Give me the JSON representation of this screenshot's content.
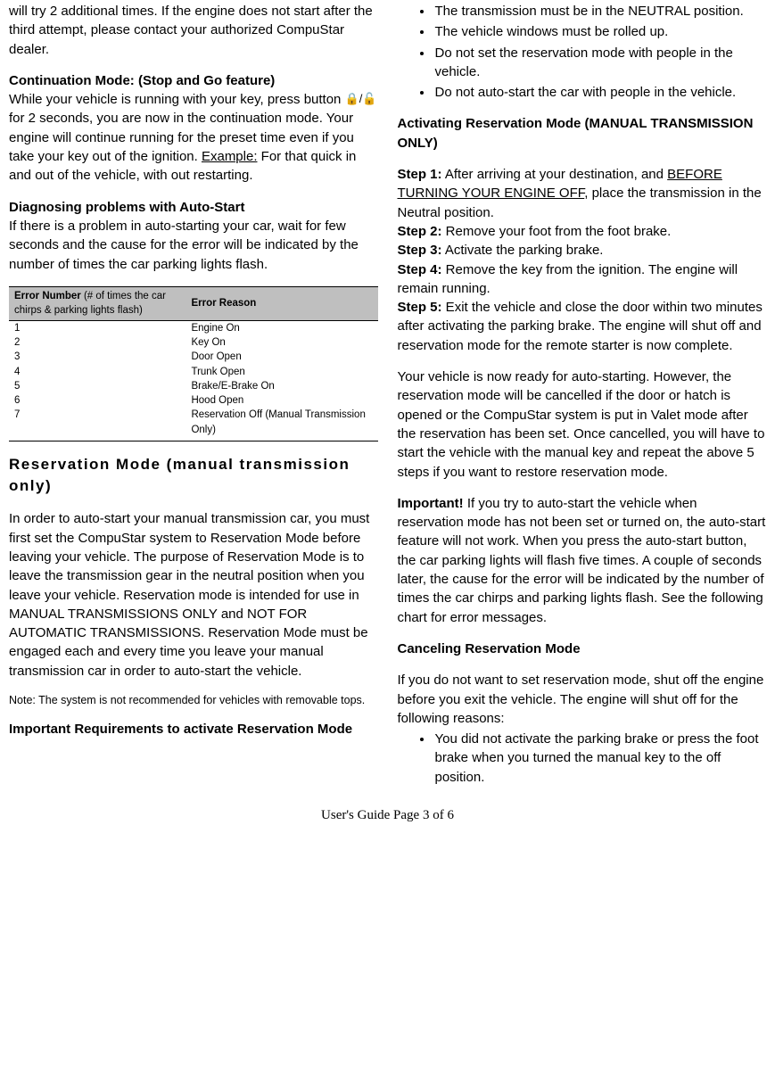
{
  "left": {
    "intro": "will try 2 additional times. If the engine does not start after the third attempt, please contact your authorized CompuStar dealer.",
    "cont_heading": "Continuation Mode: (Stop and Go feature)",
    "cont_body_a": "While your vehicle is running with your key, press button ",
    "cont_icon": "🔒/🔓",
    "cont_body_b": " for 2 seconds, you are now in the continuation mode.  Your engine will continue running for the preset time even if you take your key out of the ignition. ",
    "cont_example_label": "Example:",
    "cont_body_c": " For that quick in and out of the vehicle, with out restarting.",
    "diag_heading": "Diagnosing problems with Auto-Start",
    "diag_body": "If there is a problem in auto-starting your car, wait for few seconds and the cause for the error will be indicated by the number of times the car parking lights flash.",
    "table_h1a": "Error Number ",
    "table_h1b": "(# of times the car chirps & parking lights flash)",
    "table_h2": "Error Reason",
    "rows": [
      {
        "n": "1",
        "r": "Engine On"
      },
      {
        "n": "2",
        "r": "Key On"
      },
      {
        "n": "3",
        "r": "Door Open"
      },
      {
        "n": "4",
        "r": "Trunk Open"
      },
      {
        "n": "5",
        "r": "Brake/E-Brake On"
      },
      {
        "n": "6",
        "r": "Hood Open"
      },
      {
        "n": "7",
        "r": "Reservation Off (Manual Transmission Only)"
      }
    ],
    "res_title": "Reservation Mode (manual transmission only)",
    "res_body": "In order to auto-start your manual transmission car, you must first set the CompuStar system to Reservation Mode before leaving your vehicle. The purpose of Reservation Mode is to leave the transmission gear in the neutral position when you leave your vehicle. Reservation mode is intended for use in MANUAL TRANSMISSIONS ONLY and NOT FOR AUTOMATIC TRANSMISSIONS. Reservation Mode must be engaged each and every time you leave your manual transmission car in order to auto-start the vehicle.",
    "res_note": "Note: The system is not recommended for vehicles with removable tops.",
    "left_req_heading": "Important Requirements to activate Reservation Mode"
  },
  "right": {
    "req_bullets": [
      "The transmission must be in the NEUTRAL position.",
      "The vehicle windows must be rolled up.",
      "Do not set the reservation mode with people in the vehicle.",
      "Do not auto-start the car with people in the vehicle."
    ],
    "act_heading": "Activating Reservation Mode (MANUAL TRANSMISSION ONLY)",
    "step1_label": "Step 1:",
    "step1_a": " After arriving at your destination, and ",
    "step1_u": "BEFORE TURNING YOUR ENGINE OFF",
    "step1_b": ", place the transmission in the Neutral position.",
    "step2_label": "Step 2:",
    "step2": " Remove your foot from the foot brake.",
    "step3_label": "Step 3:",
    "step3": " Activate the parking brake.",
    "step4_label": "Step 4:",
    "step4": " Remove the key from the ignition. The engine will remain running.",
    "step5_label": "Step 5:",
    "step5": " Exit the vehicle and close the door within two minutes after activating the parking brake. The engine will shut off and reservation mode for the remote starter is now complete.",
    "ready_body": "Your vehicle is now ready for auto-starting. However, the reservation mode will be cancelled if the door or hatch is opened or the CompuStar system is put in Valet mode after the reservation has been set. Once cancelled, you will have to start the vehicle with the manual key and repeat the above 5 steps if you want to restore reservation mode.",
    "important_label": "Important!",
    "important_body": " If you try to auto-start the vehicle when reservation mode has not been set or turned on, the auto-start feature will not work. When you press the auto-start button, the car parking lights will flash five times. A couple of seconds later, the cause for the error will be indicated by the number of times the car chirps and parking lights flash.  See the following chart for error messages.",
    "cancel_heading": "Canceling Reservation Mode",
    "cancel_body": "If you do not want to set reservation mode, shut off the engine before you exit the vehicle. The engine will shut off for the following reasons:",
    "cancel_bullets": [
      "You did not activate the parking brake or press the foot brake when you turned the manual key to the off position."
    ]
  },
  "footer": "User's Guide Page 3 of 6"
}
